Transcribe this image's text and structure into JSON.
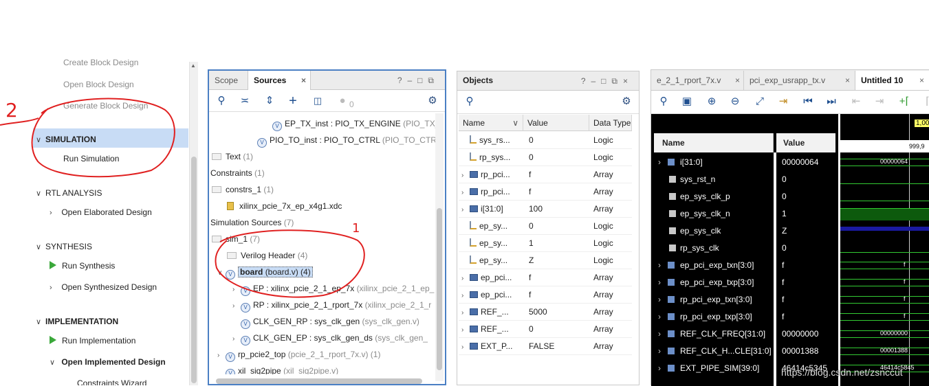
{
  "flow_navigator": {
    "items_top": [
      "Create Block Design",
      "Open Block Design",
      "Generate Block Design"
    ],
    "simulation": {
      "title": "SIMULATION",
      "run": "Run Simulation"
    },
    "rtl": {
      "title": "RTL ANALYSIS",
      "open": "Open Elaborated Design"
    },
    "synthesis": {
      "title": "SYNTHESIS",
      "run": "Run Synthesis",
      "open": "Open Synthesized Design"
    },
    "implementation": {
      "title": "IMPLEMENTATION",
      "run": "Run Implementation",
      "open": "Open Implemented Design",
      "wizard": "Constraints Wizard"
    }
  },
  "sources": {
    "tabs": [
      "Scope",
      "Sources"
    ],
    "toolbar_count": "0",
    "tree": [
      {
        "name": "EP_TX_inst : PIO_TX_ENGINE",
        "extra": "(PIO_TX_"
      },
      {
        "name": "PIO_TO_inst : PIO_TO_CTRL",
        "extra": "(PIO_TO_CTR"
      },
      {
        "name": "Text",
        "extra": "(1)"
      },
      {
        "name": "Constraints",
        "extra": "(1)"
      },
      {
        "name": "constrs_1",
        "extra": "(1)"
      },
      {
        "name": "xilinx_pcie_7x_ep_x4g1.xdc",
        "extra": ""
      },
      {
        "name": "Simulation Sources",
        "extra": "(7)"
      },
      {
        "name": "sim_1",
        "extra": "(7)"
      },
      {
        "name": "Verilog Header",
        "extra": "(4)"
      },
      {
        "name": "board",
        "extra": "(board.v) (4)"
      },
      {
        "name": "EP : xilinx_pcie_2_1_ep_7x",
        "extra": "(xilinx_pcie_2_1_ep_"
      },
      {
        "name": "RP : xilinx_pcie_2_1_rport_7x",
        "extra": "(xilinx_pcie_2_1_r"
      },
      {
        "name": "CLK_GEN_RP : sys_clk_gen",
        "extra": "(sys_clk_gen.v)"
      },
      {
        "name": "CLK_GEN_EP : sys_clk_gen_ds",
        "extra": "(sys_clk_gen_"
      },
      {
        "name": "rp_pcie2_top",
        "extra": "(pcie_2_1_rport_7x.v) (1)"
      },
      {
        "name": "xil_sig2pipe",
        "extra": "(xil_sig2pipe.v)"
      }
    ]
  },
  "objects": {
    "title": "Objects",
    "columns": [
      "Name",
      "Value",
      "Data Type"
    ],
    "rows": [
      {
        "name": "sys_rs...",
        "value": "0",
        "type": "Logic"
      },
      {
        "name": "rp_sys...",
        "value": "0",
        "type": "Logic"
      },
      {
        "name": "rp_pci...",
        "value": "f",
        "type": "Array"
      },
      {
        "name": "rp_pci...",
        "value": "f",
        "type": "Array"
      },
      {
        "name": "i[31:0]",
        "value": "100",
        "type": "Array"
      },
      {
        "name": "ep_sy...",
        "value": "0",
        "type": "Logic"
      },
      {
        "name": "ep_sy...",
        "value": "1",
        "type": "Logic"
      },
      {
        "name": "ep_sy...",
        "value": "Z",
        "type": "Logic"
      },
      {
        "name": "ep_pci...",
        "value": "f",
        "type": "Array"
      },
      {
        "name": "ep_pci...",
        "value": "f",
        "type": "Array"
      },
      {
        "name": "REF_...",
        "value": "5000",
        "type": "Array"
      },
      {
        "name": "REF_...",
        "value": "0",
        "type": "Array"
      },
      {
        "name": "EXT_P...",
        "value": "FALSE",
        "type": "Array"
      }
    ]
  },
  "wave": {
    "tabs": [
      "e_2_1_rport_7x.v",
      "pci_exp_usrapp_tx.v",
      "Untitled 10"
    ],
    "columns": [
      "Name",
      "Value"
    ],
    "cursor_label": "1,00",
    "time_label": "999,9",
    "rows": [
      {
        "name": "i[31:0]",
        "value": "00000064",
        "wave": "00000064"
      },
      {
        "name": "sys_rst_n",
        "value": "0",
        "wave": ""
      },
      {
        "name": "ep_sys_clk_p",
        "value": "0",
        "wave": ""
      },
      {
        "name": "ep_sys_clk_n",
        "value": "1",
        "wave": ""
      },
      {
        "name": "ep_sys_clk",
        "value": "Z",
        "wave": ""
      },
      {
        "name": "rp_sys_clk",
        "value": "0",
        "wave": ""
      },
      {
        "name": "ep_pci_exp_txn[3:0]",
        "value": "f",
        "wave": "f"
      },
      {
        "name": "ep_pci_exp_txp[3:0]",
        "value": "f",
        "wave": "f"
      },
      {
        "name": "rp_pci_exp_txn[3:0]",
        "value": "f",
        "wave": "f"
      },
      {
        "name": "rp_pci_exp_txp[3:0]",
        "value": "f",
        "wave": "f"
      },
      {
        "name": "REF_CLK_FREQ[31:0]",
        "value": "00000000",
        "wave": "00000000"
      },
      {
        "name": "REF_CLK_H...CLE[31:0]",
        "value": "00001388",
        "wave": "00001388"
      },
      {
        "name": "EXT_PIPE_SIM[39:0]",
        "value": "46414c5345",
        "wave": "46414c5845"
      }
    ]
  },
  "annotations": {
    "mark1": "1",
    "mark2": "2"
  },
  "watermark": "https://blog.csdn.net/zsnccut"
}
